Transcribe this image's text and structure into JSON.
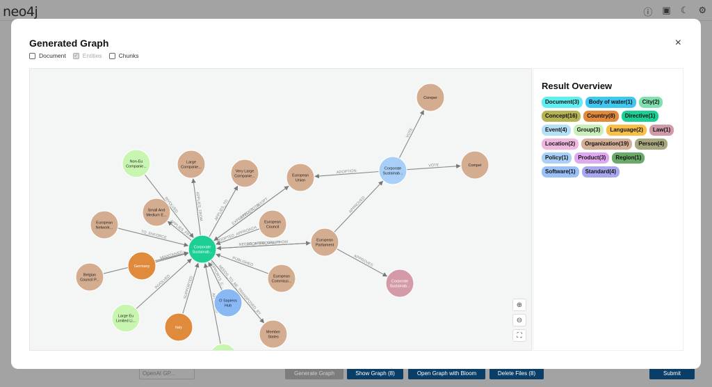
{
  "app": {
    "logo": "neo4j",
    "icons": [
      "info-icon",
      "api-icon",
      "moon-icon",
      "gear-icon"
    ]
  },
  "background": {
    "model_select": "OpenAI GP...",
    "buttons": {
      "generate": "Generate Graph",
      "show": "Show Graph (8)",
      "bloom": "Open Graph with Bloom",
      "delete": "Delete Files (8)",
      "submit": "Submit"
    }
  },
  "modal": {
    "title": "Generated Graph",
    "close": "×",
    "filters": [
      {
        "label": "Document",
        "checked": false,
        "disabled": false
      },
      {
        "label": "Entities",
        "checked": true,
        "disabled": true
      },
      {
        "label": "Chunks",
        "checked": false,
        "disabled": false
      }
    ],
    "overview": {
      "title": "Result Overview",
      "labels": [
        {
          "text": "Document(3)",
          "color": "#5ef0f0"
        },
        {
          "text": "Body of water(1)",
          "color": "#3cc8f0"
        },
        {
          "text": "City(2)",
          "color": "#7fe0b0"
        },
        {
          "text": "Concept(16)",
          "color": "#b5b455"
        },
        {
          "text": "Country(8)",
          "color": "#e08a3c"
        },
        {
          "text": "Directive(1)",
          "color": "#1ccf95"
        },
        {
          "text": "Event(4)",
          "color": "#b6e0f8"
        },
        {
          "text": "Group(3)",
          "color": "#c8f0b8"
        },
        {
          "text": "Language(2)",
          "color": "#f8c048"
        },
        {
          "text": "Law(1)",
          "color": "#d19aa8"
        },
        {
          "text": "Location(2)",
          "color": "#f0b8e0"
        },
        {
          "text": "Organization(19)",
          "color": "#d4b098"
        },
        {
          "text": "Person(4)",
          "color": "#a8a880"
        },
        {
          "text": "Policy(1)",
          "color": "#a8d0f8"
        },
        {
          "text": "Product(3)",
          "color": "#e0a8f0"
        },
        {
          "text": "Region(1)",
          "color": "#6aaa68"
        },
        {
          "text": "Software(1)",
          "color": "#9ac0f8"
        },
        {
          "text": "Standard(4)",
          "color": "#a8a8f0"
        }
      ]
    },
    "graph": {
      "nodes": [
        {
          "label": [
            "Corporate",
            "Sustainab..."
          ],
          "color": "#1ccf95",
          "text": "#fff"
        },
        {
          "label": [
            "Non-Eu",
            "Companie..."
          ],
          "color": "#c8f5b0"
        },
        {
          "label": [
            "Large",
            "Companie..."
          ],
          "color": "#d4ad91"
        },
        {
          "label": [
            "Very Large",
            "Companie..."
          ],
          "color": "#d4ad91"
        },
        {
          "label": [
            "European",
            "Union"
          ],
          "color": "#d4ad91"
        },
        {
          "label": [
            "Small And",
            "Medium E..."
          ],
          "color": "#d4ad91"
        },
        {
          "label": [
            "European",
            "Network..."
          ],
          "color": "#d4ad91"
        },
        {
          "label": [
            "European",
            "Council"
          ],
          "color": "#d4ad91"
        },
        {
          "label": [
            "European",
            "Parliament"
          ],
          "color": "#d4ad91"
        },
        {
          "label": [
            "Germany"
          ],
          "color": "#e08a3c",
          "text": "#fff"
        },
        {
          "label": [
            "Belgian",
            "Council P..."
          ],
          "color": "#d4ad91"
        },
        {
          "label": [
            "European",
            "Commissi..."
          ],
          "color": "#d4ad91"
        },
        {
          "label": [
            "O Sapiens",
            "Hub"
          ],
          "color": "#8ab8f5",
          "text": "#123"
        },
        {
          "label": [
            "Large Eu",
            "Limited Li..."
          ],
          "color": "#c8f5b0"
        },
        {
          "label": [
            "Italy"
          ],
          "color": "#e08a3c",
          "text": "#fff"
        },
        {
          "label": [
            "Member",
            "States"
          ],
          "color": "#d4ad91"
        },
        {
          "label": [
            "Sines"
          ],
          "color": "#c8f5b0"
        },
        {
          "label": [
            "Corporate",
            "Sustainab..."
          ],
          "color": "#a8cff8"
        },
        {
          "label": [
            "Coreper"
          ],
          "color": "#d4ad91"
        },
        {
          "label": [
            "Compel"
          ],
          "color": "#d4ad91"
        },
        {
          "label": [
            "Corporate",
            "Sustainab..."
          ],
          "color": "#d49aa8",
          "text": "#fff"
        }
      ],
      "edges": [
        {
          "from": 1,
          "to": 0,
          "label": "INVOLVED"
        },
        {
          "from": 0,
          "to": 2,
          "label": "APPLIES_FROM"
        },
        {
          "from": 0,
          "to": 3,
          "label": "APPLIES_TO"
        },
        {
          "from": 0,
          "to": 4,
          "label": "APPLIES_TO"
        },
        {
          "from": 4,
          "to": 0,
          "label": "EXPECTED_TO_ADOPT"
        },
        {
          "from": 0,
          "to": 5,
          "label": "APPLIES_FR..."
        },
        {
          "from": 6,
          "to": 0,
          "label": "TO_ENFORCE"
        },
        {
          "from": 7,
          "to": 0,
          "label": "ADOPTED_APPROACH"
        },
        {
          "from": 0,
          "to": 8,
          "label": "NEEDS_APPROVAL_FROM"
        },
        {
          "from": 8,
          "to": 0,
          "label": "ADOPTED_DRAFT"
        },
        {
          "from": 9,
          "to": 0,
          "label": "MAINTAINED"
        },
        {
          "from": 10,
          "to": 0,
          "label": "AN..."
        },
        {
          "from": 11,
          "to": 0,
          "label": "PUBLISHED"
        },
        {
          "from": 12,
          "to": 0,
          "label": "SUPPORTS_C..."
        },
        {
          "from": 0,
          "to": 15,
          "label": "NEEDS_TO_BE_TRANSPOSED_BY"
        },
        {
          "from": 13,
          "to": 0,
          "label": "INVOLVED"
        },
        {
          "from": 14,
          "to": 0,
          "label": "SUPPORTED"
        },
        {
          "from": 16,
          "to": 0,
          "label": "AFFECTED"
        },
        {
          "from": 17,
          "to": 4,
          "label": "ADOPTION"
        },
        {
          "from": 17,
          "to": 18,
          "label": "VOTE"
        },
        {
          "from": 17,
          "to": 19,
          "label": "VOTE"
        },
        {
          "from": 8,
          "to": 17,
          "label": "APPROVED"
        },
        {
          "from": 8,
          "to": 20,
          "label": "APPROVES"
        }
      ]
    },
    "zoom_controls": [
      "zoom-in",
      "zoom-out",
      "fit"
    ]
  }
}
